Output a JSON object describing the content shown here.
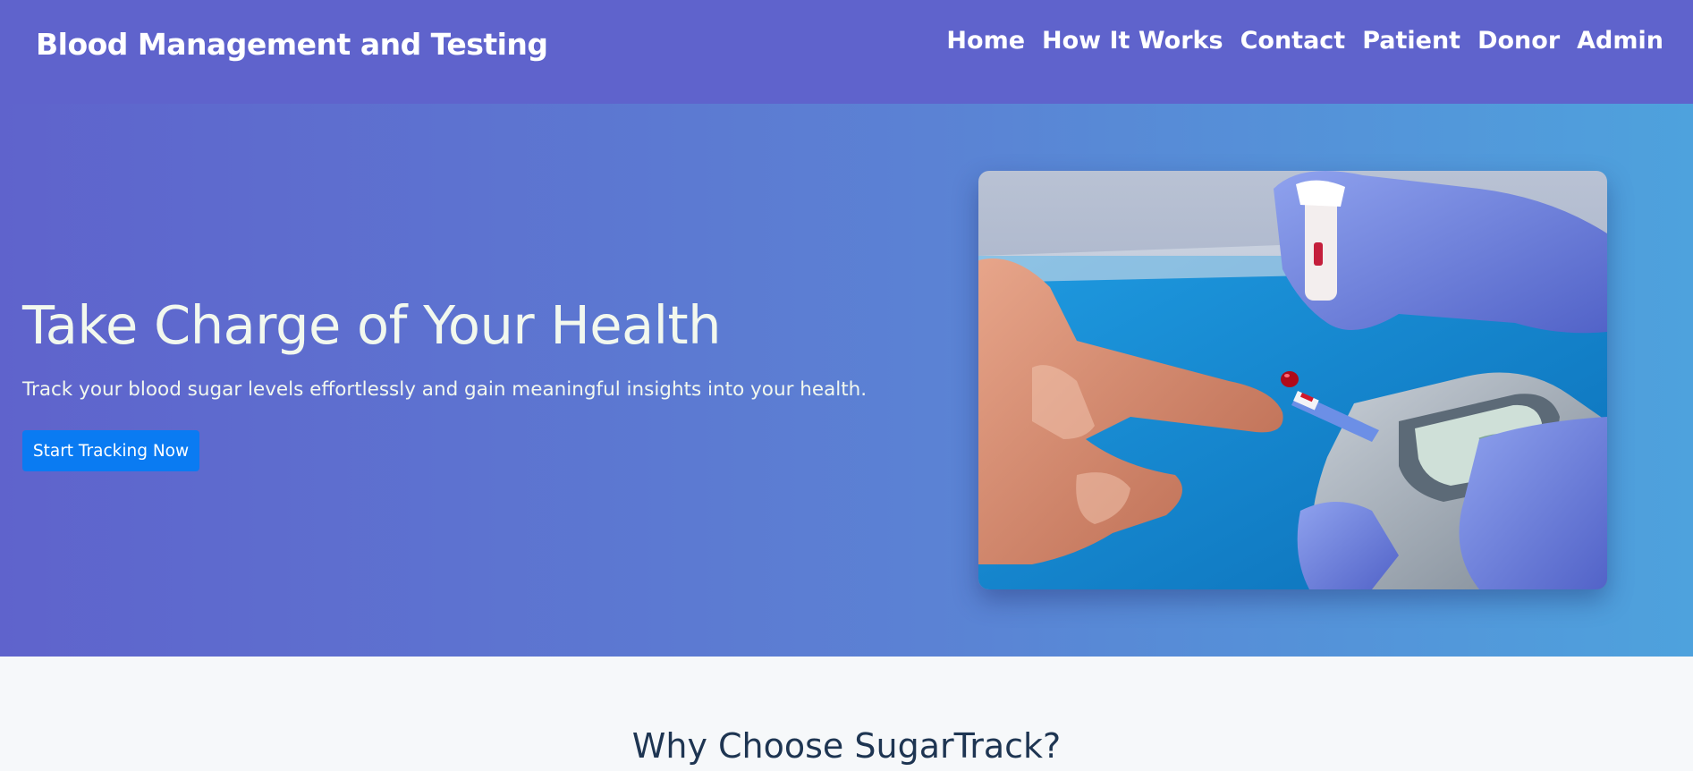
{
  "navbar": {
    "brand": "Blood Management and Testing",
    "links": [
      "Home",
      "How It Works",
      "Contact",
      "Patient",
      "Donor",
      "Admin"
    ]
  },
  "hero": {
    "title": "Take Charge of Your Health",
    "subtitle": "Track your blood sugar levels effortlessly and gain meaningful insights into your health.",
    "cta_label": "Start Tracking Now"
  },
  "features": {
    "title": "Why Choose SugarTrack?"
  },
  "colors": {
    "navbar_bg": "#5f63cc",
    "hero_gradient_start": "#5f63cc",
    "hero_gradient_end": "#4ea2dd",
    "cta_bg": "#0a7bf2",
    "section_title": "#1e3552"
  }
}
